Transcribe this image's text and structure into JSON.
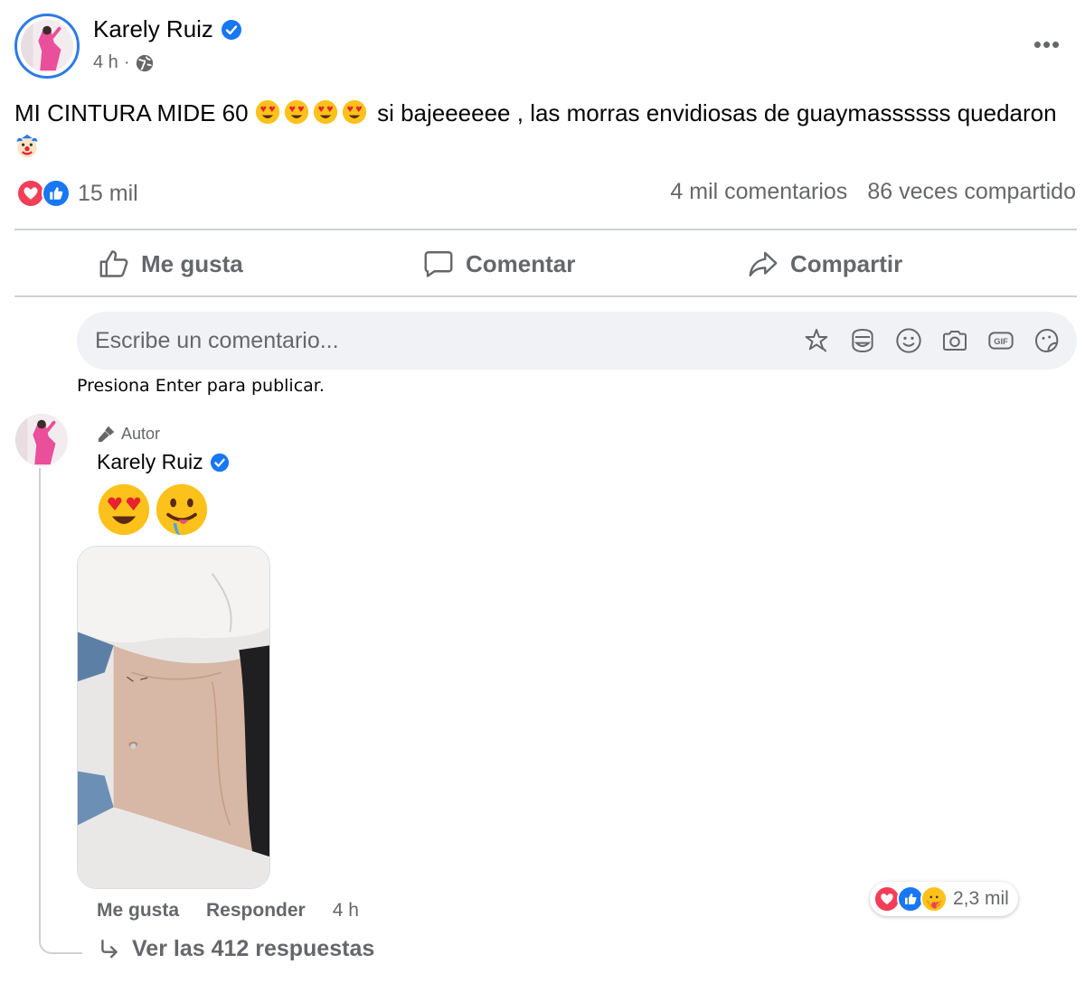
{
  "post": {
    "author": "Karely Ruiz",
    "time": "4 h",
    "separator": "·",
    "text_part1": "MI CINTURA MIDE 60",
    "text_part2": "si bajeeeeee , las morras envidiosas de guaymassssss quedaron",
    "more_label": "•••",
    "reactions_count": "15 mil",
    "comments_count": "4 mil comentarios",
    "shares_count": "86 veces compartido"
  },
  "actions": {
    "like": "Me gusta",
    "comment": "Comentar",
    "share": "Compartir"
  },
  "composer": {
    "placeholder": "Escribe un comentario...",
    "hint": "Presiona Enter para publicar.",
    "icons": [
      "sticker-star-icon",
      "avatar-sticker-icon",
      "emoji-icon",
      "camera-icon",
      "gif-icon",
      "sticker-icon"
    ]
  },
  "comment": {
    "badge": "Autor",
    "author": "Karely Ruiz",
    "like": "Me gusta",
    "reply": "Responder",
    "time": "4 h",
    "reactions_count": "2,3 mil",
    "replies": "Ver las 412 respuestas"
  },
  "colors": {
    "verified_blue": "#1877f2",
    "love_red": "#f33e58",
    "like_blue": "#1877f2",
    "secondary_text": "#65676b"
  }
}
